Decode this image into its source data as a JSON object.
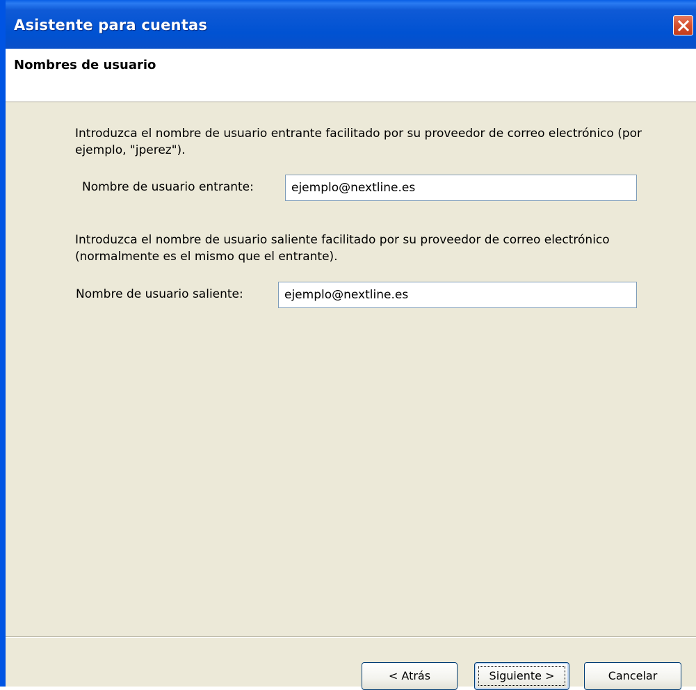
{
  "window": {
    "title": "Asistente para cuentas"
  },
  "header": {
    "title": "Nombres de usuario"
  },
  "incoming": {
    "description": "Introduzca el nombre de usuario entrante facilitado por su proveedor de correo electrónico (por ejemplo, \"jperez\").",
    "label": "Nombre de usuario entrante:",
    "value": "ejemplo@nextline.es"
  },
  "outgoing": {
    "description": "Introduzca el nombre de usuario saliente facilitado por su proveedor de correo electrónico (normalmente es el mismo que el entrante).",
    "label": "Nombre de usuario saliente:",
    "value": "ejemplo@nextline.es"
  },
  "buttons": {
    "back": "< Atrás",
    "next": "Siguiente >",
    "cancel": "Cancelar"
  },
  "icons": {
    "close": "close-icon"
  },
  "colors": {
    "titlebar": "#0054E3",
    "dialog_bg": "#ECE9D8",
    "close_button": "#D5502E"
  }
}
